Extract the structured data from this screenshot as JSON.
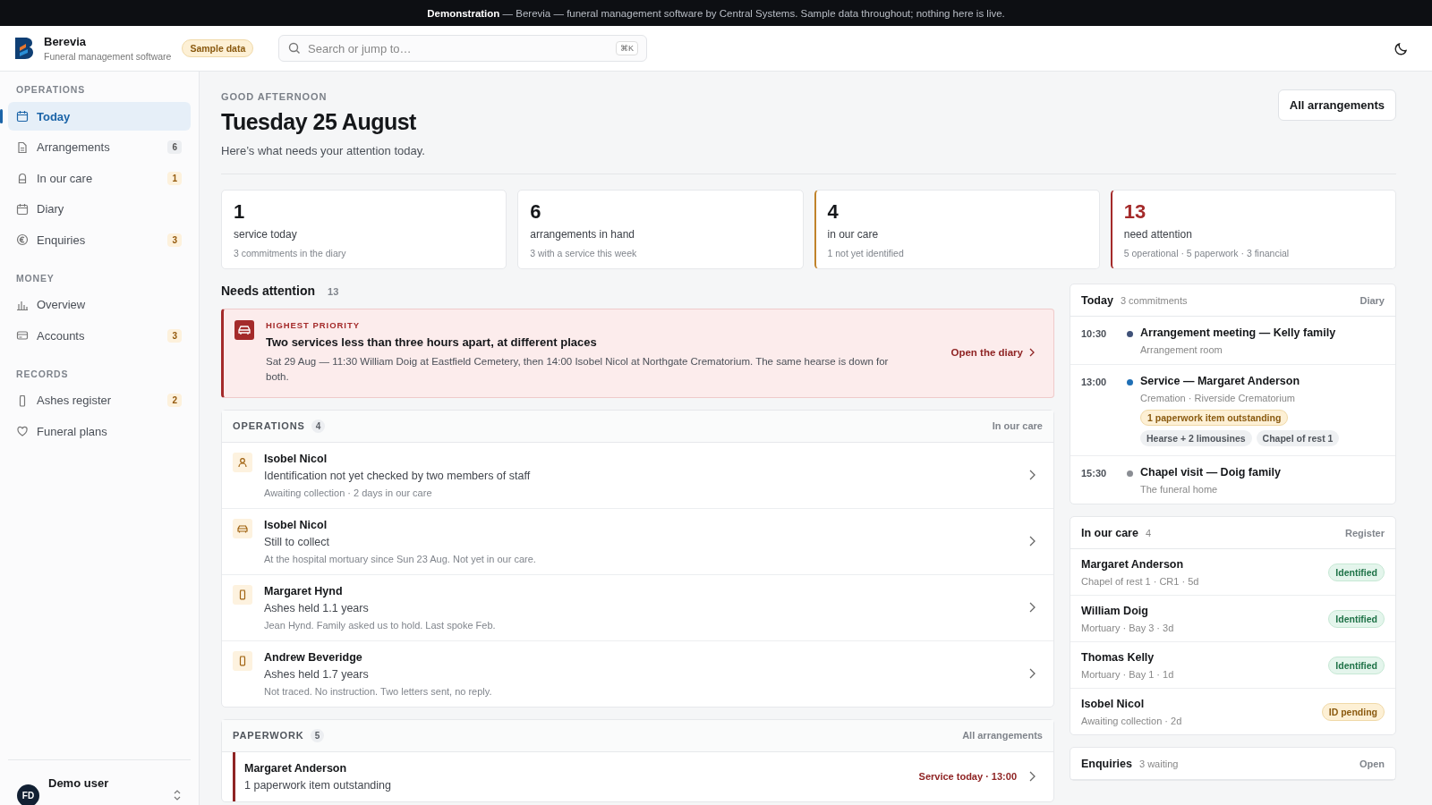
{
  "banner": "**Demonstration** — Berevia — funeral management software by Central Systems. Sample data throughout; nothing here is live.",
  "brand": {
    "name": "Berevia",
    "tagline": "Funeral management software",
    "badge": "Sample data"
  },
  "search": {
    "placeholder": "Search or jump to…",
    "shortcut": "⌘K"
  },
  "sidebar": {
    "sections": [
      {
        "title": "OPERATIONS",
        "items": [
          {
            "label": "Today",
            "selected": true
          },
          {
            "label": "Arrangements",
            "selected": false,
            "count": "6",
            "kind": "neutral"
          },
          {
            "label": "In our care",
            "selected": false,
            "count": "1",
            "kind": "warning"
          },
          {
            "label": "Diary",
            "selected": false
          },
          {
            "label": "Enquiries",
            "selected": false,
            "count": "3",
            "kind": "warning"
          }
        ]
      },
      {
        "title": "MONEY",
        "items": [
          {
            "label": "Overview",
            "selected": false
          },
          {
            "label": "Accounts",
            "selected": false,
            "count": "3",
            "kind": "warning"
          }
        ]
      },
      {
        "title": "RECORDS",
        "items": [
          {
            "label": "Ashes register",
            "selected": false,
            "count": "2",
            "kind": "warning"
          },
          {
            "label": "Funeral plans",
            "selected": false
          }
        ]
      }
    ],
    "user": {
      "initials": "FD",
      "name": "Demo user"
    }
  },
  "greeting": "GOOD AFTERNOON",
  "title": "Tuesday 25 August",
  "subtitle": "Here’s what needs your attention today.",
  "primary_button": "All arrangements",
  "stats": [
    {
      "value": "1",
      "label": "service today",
      "note": "3 commitments in the diary",
      "kind": "plain"
    },
    {
      "value": "6",
      "label": "arrangements in hand",
      "note": "3 with a service this week",
      "kind": "plain"
    },
    {
      "value": "4",
      "label": "in our care",
      "note": "1 not yet identified",
      "kind": "warning"
    },
    {
      "value": "13",
      "label": "need attention",
      "note": "5 operational · 5 paperwork · 3 financial",
      "kind": "danger"
    }
  ],
  "attention": {
    "title": "Needs attention",
    "count": "13",
    "priority": {
      "eyebrow": "HIGHEST PRIORITY",
      "title": "Two services less than three hours apart, at different places",
      "text": "Sat 29 Aug — 11:30 William Doig at Eastfield Cemetery, then 14:00 Isobel Nicol at Northgate Crematorium. The same hearse is down for both.",
      "link": "Open the diary"
    },
    "groups": [
      {
        "title": "OPERATIONS",
        "count": "4",
        "link": "In our care",
        "rows": [
          {
            "kind": "person",
            "name": "Isobel Nicol",
            "line": "Identification not yet checked by two members of staff",
            "note": "Awaiting collection · 2 days in our care"
          },
          {
            "kind": "car",
            "name": "Isobel Nicol",
            "line": "Still to collect",
            "note": "At the hospital mortuary since Sun 23 Aug. Not yet in our care."
          },
          {
            "kind": "urn",
            "name": "Margaret Hynd",
            "line": "Ashes held 1.1 years",
            "note": "Jean Hynd. Family asked us to hold. Last spoke Feb."
          },
          {
            "kind": "urn",
            "name": "Andrew Beveridge",
            "line": "Ashes held 1.7 years",
            "note": "Not traced. No instruction. Two letters sent, no reply."
          }
        ]
      },
      {
        "title": "PAPERWORK",
        "count": "5",
        "link": "All arrangements",
        "rows": [
          {
            "kind": "flagged",
            "name": "Margaret Anderson",
            "line": "1 paperwork item outstanding",
            "due": "Service today · 13:00"
          }
        ]
      }
    ]
  },
  "diary": {
    "title": "Today",
    "count": "3 commitments",
    "link": "Diary",
    "items": [
      {
        "time": "10:30",
        "color": "#3f5178",
        "title": "Arrangement meeting — Kelly family",
        "place": "Arrangement room"
      },
      {
        "time": "13:00",
        "color": "#1f6fb5",
        "title": "Service — Margaret Anderson",
        "place": "Cremation · Riverside Crematorium",
        "alert": "1 paperwork item outstanding",
        "tags": [
          "Hearse + 2 limousines",
          "Chapel of rest 1"
        ]
      },
      {
        "time": "15:30",
        "color": "#8a8d93",
        "title": "Chapel visit — Doig family",
        "place": "The funeral home"
      }
    ]
  },
  "care": {
    "title": "In our care",
    "count": "4",
    "link": "Register",
    "items": [
      {
        "name": "Margaret Anderson",
        "place": "Chapel of rest 1 · CR1 · 5d",
        "status": "Identified",
        "kind": "ok"
      },
      {
        "name": "William Doig",
        "place": "Mortuary · Bay 3 · 3d",
        "status": "Identified",
        "kind": "ok"
      },
      {
        "name": "Thomas Kelly",
        "place": "Mortuary · Bay 1 · 1d",
        "status": "Identified",
        "kind": "ok"
      },
      {
        "name": "Isobel Nicol",
        "place": "Awaiting collection · 2d",
        "status": "ID pending",
        "kind": "pending"
      }
    ]
  },
  "enquiries": {
    "title": "Enquiries",
    "count": "3 waiting",
    "link": "Open"
  }
}
